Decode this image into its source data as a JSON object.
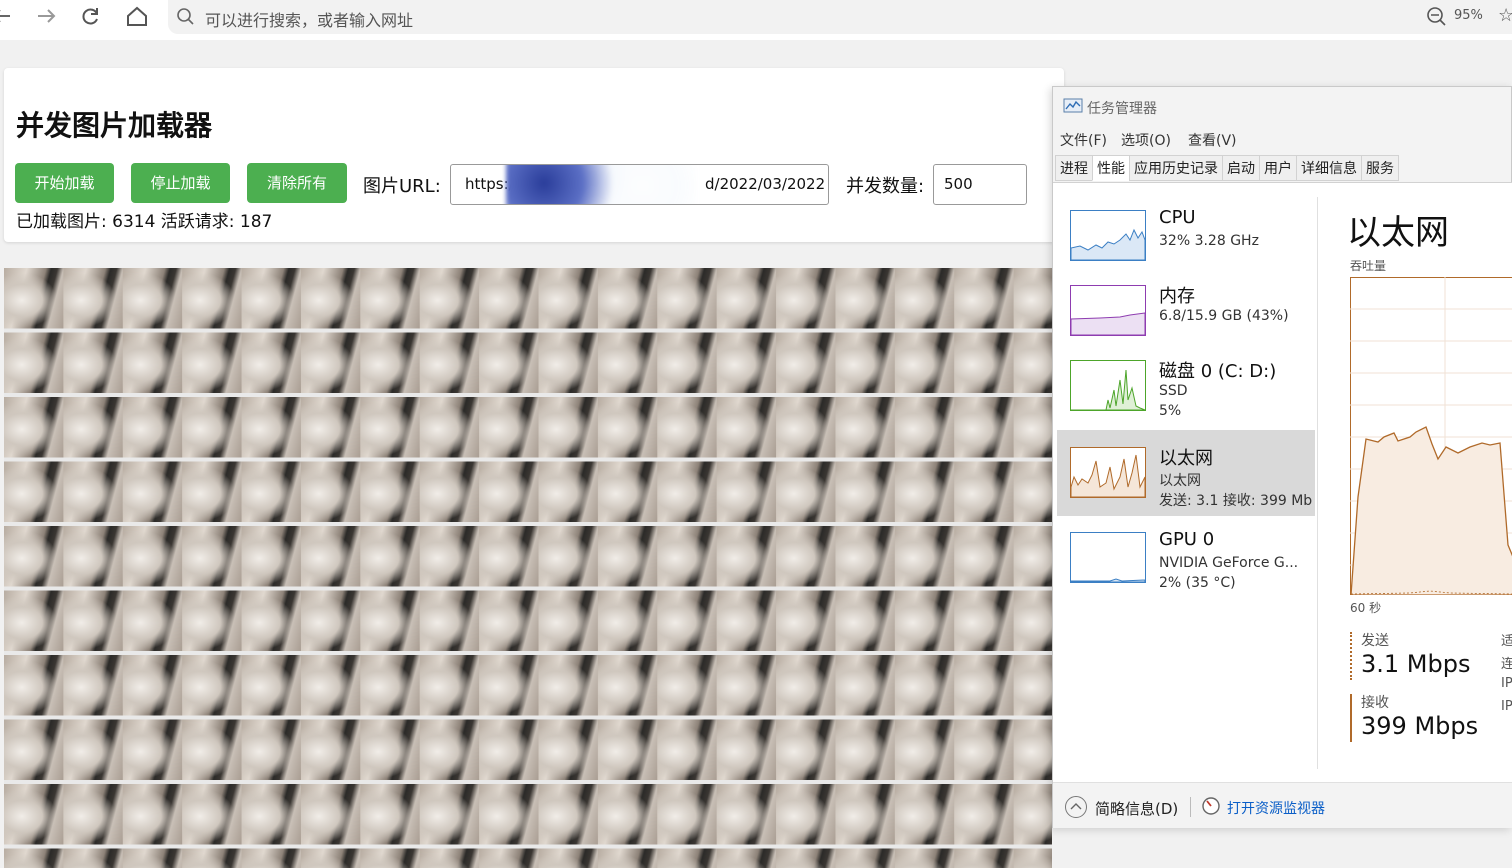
{
  "browser": {
    "address_placeholder": "可以进行搜索，或者输入网址",
    "zoom_level": "95%",
    "icons": [
      "back-arrow-icon",
      "forward-arrow-icon",
      "refresh-icon",
      "home-icon",
      "search-icon",
      "zoom-out-icon",
      "star-icon"
    ]
  },
  "app": {
    "title": "并发图片加载器",
    "buttons": {
      "start": "开始加载",
      "stop": "停止加载",
      "clear": "清除所有"
    },
    "url_label": "图片URL:",
    "url_value": "https://",
    "url_value_tail": "d/2022/03/2022",
    "concurrency_label": "并发数量:",
    "concurrency_value": "500",
    "stats": "已加载图片: 6314 活跃请求: 187",
    "accent_color": "#4caf50"
  },
  "task_manager": {
    "window_title": "任务管理器",
    "menu": [
      "文件(F)",
      "选项(O)",
      "查看(V)"
    ],
    "tabs": [
      "进程",
      "性能",
      "应用历史记录",
      "启动",
      "用户",
      "详细信息",
      "服务"
    ],
    "active_tab": "性能",
    "resources": [
      {
        "name": "CPU",
        "line1": "32%  3.28 GHz",
        "line2": "",
        "color": "#3b7fc4"
      },
      {
        "name": "内存",
        "line1": "6.8/15.9 GB (43%)",
        "line2": "",
        "color": "#8e3cb0"
      },
      {
        "name": "磁盘 0 (C: D:)",
        "line1": "SSD",
        "line2": "5%",
        "color": "#4da52a"
      },
      {
        "name": "以太网",
        "line1": "以太网",
        "line2": "发送: 3.1  接收: 399 Mb",
        "color": "#b06a2a"
      },
      {
        "name": "GPU 0",
        "line1": "NVIDIA GeForce G...",
        "line2": "2%  (35 °C)",
        "color": "#3b7fc4"
      }
    ],
    "selected_resource": "以太网",
    "detail": {
      "title": "以太网",
      "throughput_label": "吞吐量",
      "time_label": "60 秒",
      "send_label": "发送",
      "send_value": "3.1 Mbps",
      "recv_label": "接收",
      "recv_value": "399 Mbps",
      "clipped_labels": [
        "适",
        "连",
        "IP",
        "IP"
      ]
    },
    "footer": {
      "fewer_details": "简略信息(D)",
      "resource_monitor": "打开资源监视器"
    }
  }
}
